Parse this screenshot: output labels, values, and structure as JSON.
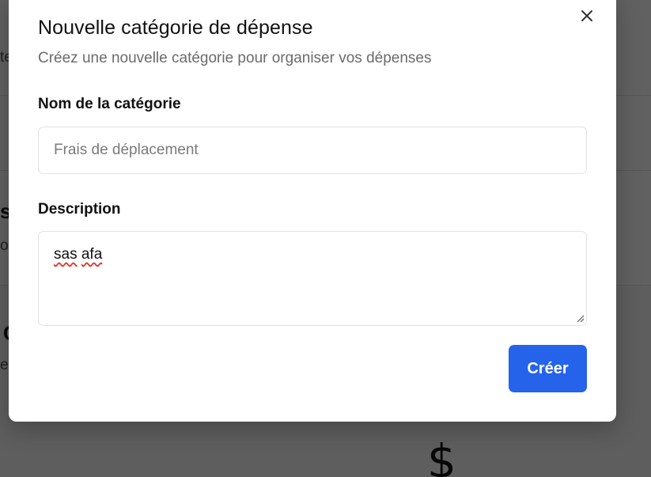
{
  "dialog": {
    "title": "Nouvelle catégorie de dépense",
    "subtitle": "Créez une nouvelle catégorie pour organiser vos dépenses",
    "close_icon": "close-icon"
  },
  "form": {
    "name_label": "Nom de la catégorie",
    "name_value": "",
    "name_placeholder": "Frais de déplacement",
    "description_label": "Description",
    "description_value": "sas afa",
    "description_words": [
      "sas",
      "afa"
    ]
  },
  "actions": {
    "create_label": "Créer"
  },
  "colors": {
    "primary": "#2563eb",
    "overlay": "rgba(0,0,0,0.62)",
    "muted_text": "#6b6b6b"
  },
  "background": {
    "fragment_1": "te",
    "fragment_2": "s",
    "fragment_3": "o",
    "fragment_4": "C",
    "fragment_5": "e",
    "dollar_icon": "dollar-icon"
  }
}
